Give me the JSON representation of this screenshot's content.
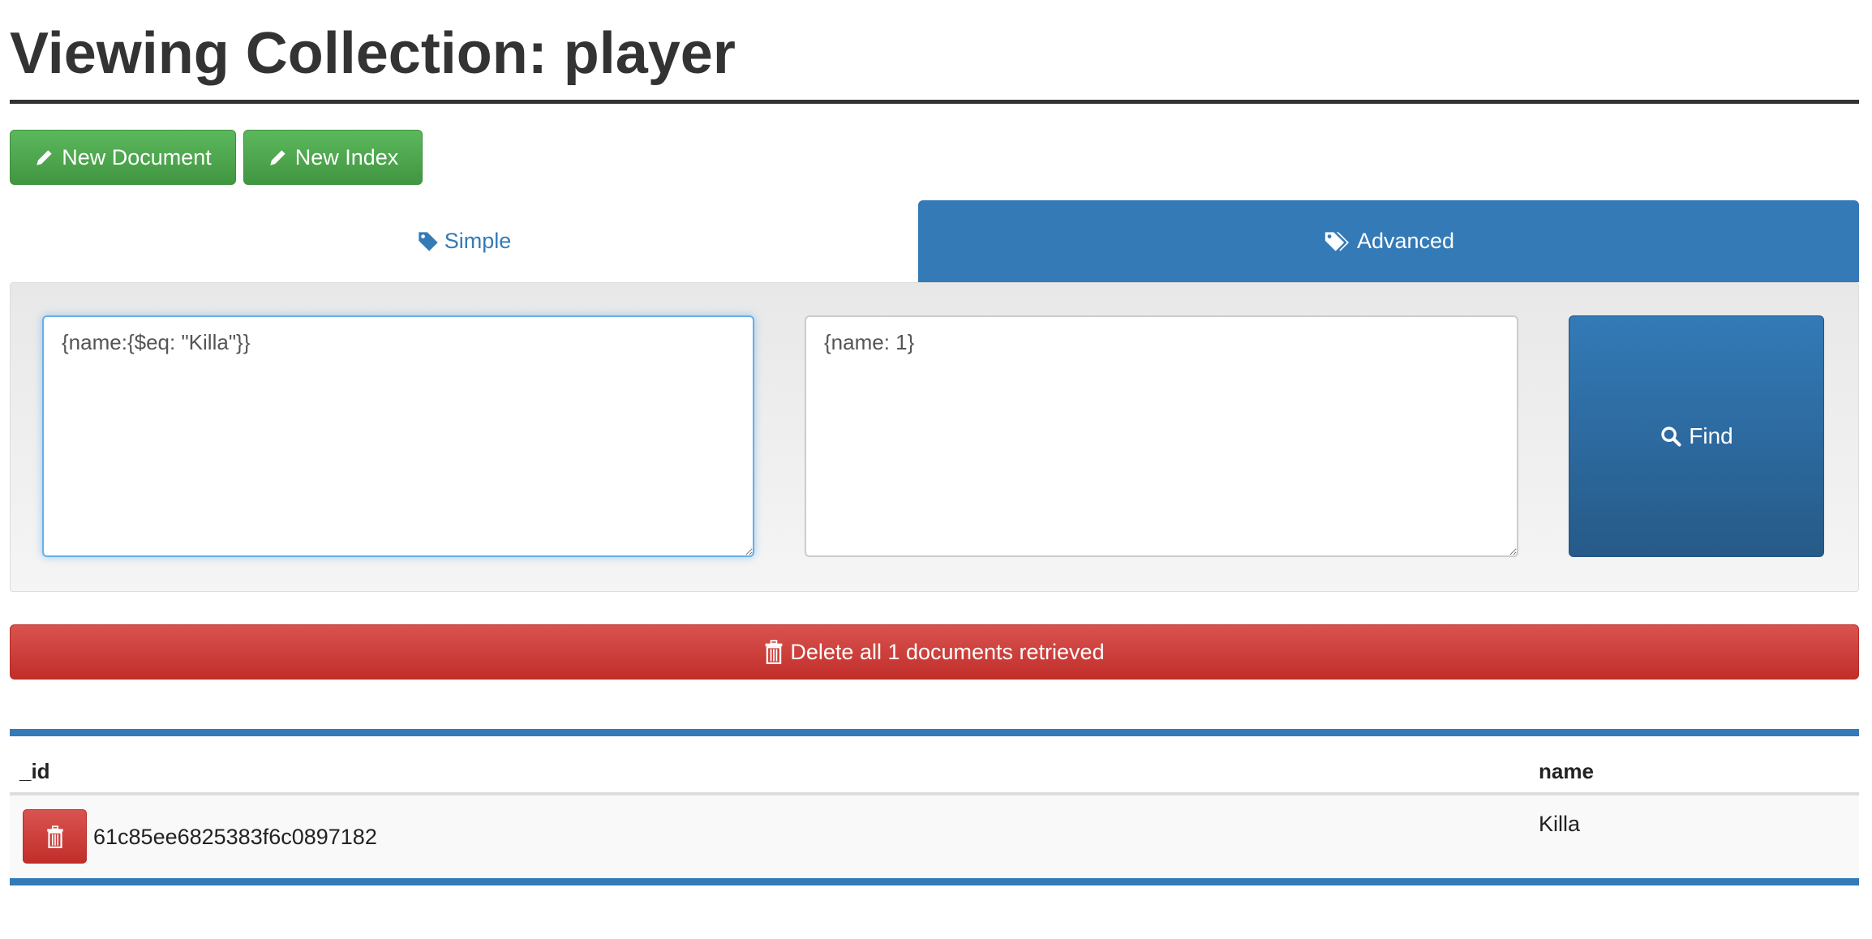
{
  "page_title": "Viewing Collection: player",
  "toolbar": {
    "new_document": "New Document",
    "new_index": "New Index"
  },
  "tabs": {
    "simple": "Simple",
    "advanced": "Advanced",
    "active": "Advanced"
  },
  "query": {
    "filter": "{name:{$eq: \"Killa\"}}",
    "projection": "{name: 1}",
    "find_label": "Find"
  },
  "delete_all_label": "Delete all 1 documents retrieved",
  "table": {
    "columns": [
      "_id",
      "name"
    ],
    "rows": [
      {
        "_id": "61c85ee6825383f6c0897182",
        "name": "Killa"
      }
    ]
  },
  "colors": {
    "primary": "#337ab7",
    "success": "#5cb85c",
    "danger": "#d9534f"
  }
}
